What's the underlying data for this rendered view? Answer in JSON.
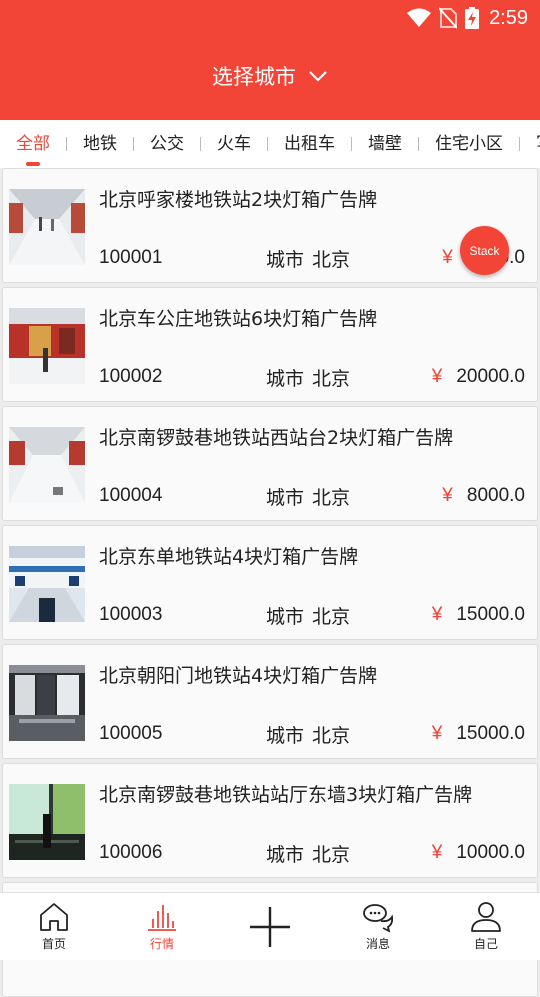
{
  "status_bar": {
    "time": "2:59"
  },
  "header": {
    "title": "选择城市"
  },
  "tabs": [
    {
      "label": "全部",
      "active": true
    },
    {
      "label": "地铁"
    },
    {
      "label": "公交"
    },
    {
      "label": "火车"
    },
    {
      "label": "出租车"
    },
    {
      "label": "墙壁"
    },
    {
      "label": "住宅小区"
    },
    {
      "label": "写"
    }
  ],
  "listings": [
    {
      "title": "北京呼家楼地铁站2块灯箱广告牌",
      "id": "100001",
      "city_label": "城市",
      "city": "北京",
      "currency": "¥",
      "price": "8000.0"
    },
    {
      "title": "北京车公庄地铁站6块灯箱广告牌",
      "id": "100002",
      "city_label": "城市",
      "city": "北京",
      "currency": "¥",
      "price": "20000.0"
    },
    {
      "title": "北京南锣鼓巷地铁站西站台2块灯箱广告牌",
      "id": "100004",
      "city_label": "城市",
      "city": "北京",
      "currency": "¥",
      "price": "8000.0"
    },
    {
      "title": "北京东单地铁站4块灯箱广告牌",
      "id": "100003",
      "city_label": "城市",
      "city": "北京",
      "currency": "¥",
      "price": "15000.0"
    },
    {
      "title": "北京朝阳门地铁站4块灯箱广告牌",
      "id": "100005",
      "city_label": "城市",
      "city": "北京",
      "currency": "¥",
      "price": "15000.0"
    },
    {
      "title": "北京南锣鼓巷地铁站站厅东墙3块灯箱广告牌",
      "id": "100006",
      "city_label": "城市",
      "city": "北京",
      "currency": "¥",
      "price": "10000.0"
    }
  ],
  "floating_button": {
    "label": "Stack"
  },
  "bottom_nav": [
    {
      "label": "首页",
      "icon": "home-icon"
    },
    {
      "label": "行情",
      "icon": "chart-icon",
      "active": true
    },
    {
      "label": "",
      "icon": "plus-icon"
    },
    {
      "label": "消息",
      "icon": "message-icon"
    },
    {
      "label": "自己",
      "icon": "user-icon"
    }
  ],
  "colors": {
    "accent": "#f24538"
  }
}
